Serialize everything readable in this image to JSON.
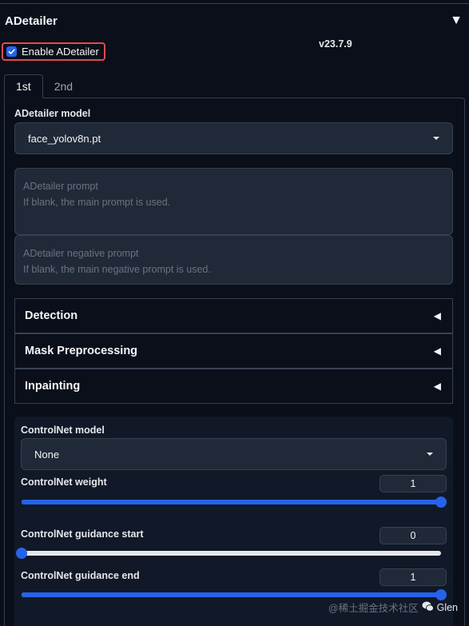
{
  "section": {
    "title": "ADetailer",
    "collapse_icon": "triangle-down-icon",
    "enable_label": "Enable ADetailer",
    "enable_checked": true,
    "version": "v23.7.9"
  },
  "tabs": [
    {
      "label": "1st",
      "active": true
    },
    {
      "label": "2nd",
      "active": false
    }
  ],
  "model": {
    "label": "ADetailer model",
    "value": "face_yolov8n.pt"
  },
  "prompt": {
    "placeholder_title": "ADetailer prompt",
    "placeholder_hint": "If blank, the main prompt is used."
  },
  "negative_prompt": {
    "placeholder_title": "ADetailer negative prompt",
    "placeholder_hint": "If blank, the main negative prompt is used."
  },
  "accordions": [
    {
      "label": "Detection"
    },
    {
      "label": "Mask Preprocessing"
    },
    {
      "label": "Inpainting"
    }
  ],
  "controlnet": {
    "model_label": "ControlNet model",
    "model_value": "None",
    "weight": {
      "label": "ControlNet weight",
      "value": "1",
      "fraction": 1.0
    },
    "guidance_start": {
      "label": "ControlNet guidance start",
      "value": "0",
      "fraction": 0.0
    },
    "guidance_end": {
      "label": "ControlNet guidance end",
      "value": "1",
      "fraction": 1.0
    }
  },
  "watermark": {
    "faint_text": "@稀土掘金技术社区",
    "name": "Glen"
  },
  "colors": {
    "background": "#0b0f19",
    "accent": "#2563eb",
    "highlight_border": "#e24b4b"
  }
}
